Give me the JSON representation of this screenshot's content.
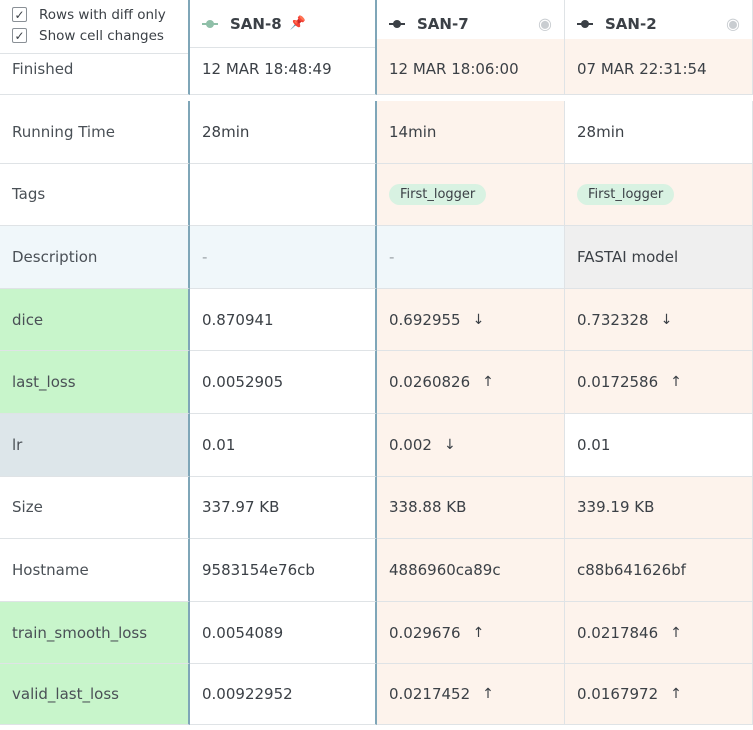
{
  "options": {
    "rows_with_diff_only": "Rows with diff only",
    "show_cell_changes": "Show cell changes"
  },
  "experiments": [
    {
      "name": "SAN-8",
      "icon": "experiment-light-icon",
      "marker": "pin-icon"
    },
    {
      "name": "SAN-7",
      "icon": "experiment-icon",
      "marker": "eye-icon"
    },
    {
      "name": "SAN-2",
      "icon": "experiment-icon",
      "marker": "eye-icon"
    }
  ],
  "rows": [
    {
      "label": "Finished",
      "values": [
        "12 MAR 18:48:49",
        "12 MAR 18:06:00",
        "07 MAR 22:31:54"
      ]
    },
    {
      "label": "Running Time",
      "values": [
        "28min",
        "14min",
        "28min"
      ]
    },
    {
      "label": "Tags",
      "values": [
        "",
        "First_logger",
        "First_logger"
      ]
    },
    {
      "label": "Description",
      "values": [
        "-",
        "-",
        "FASTAI model"
      ]
    },
    {
      "label": "dice",
      "values": [
        "0.870941",
        "0.692955",
        "0.732328"
      ],
      "arrows": [
        "",
        "↓",
        "↓"
      ]
    },
    {
      "label": "last_loss",
      "values": [
        "0.0052905",
        "0.0260826",
        "0.0172586"
      ],
      "arrows": [
        "",
        "↑",
        "↑"
      ]
    },
    {
      "label": "lr",
      "values": [
        "0.01",
        "0.002",
        "0.01"
      ],
      "arrows": [
        "",
        "↓",
        ""
      ]
    },
    {
      "label": "Size",
      "values": [
        "337.97 KB",
        "338.88 KB",
        "339.19 KB"
      ]
    },
    {
      "label": "Hostname",
      "values": [
        "9583154e76cb",
        "4886960ca89c",
        "c88b641626bf"
      ]
    },
    {
      "label": "train_smooth_loss",
      "values": [
        "0.0054089",
        "0.029676",
        "0.0217846"
      ],
      "arrows": [
        "",
        "↑",
        "↑"
      ]
    },
    {
      "label": "valid_last_loss",
      "values": [
        "0.00922952",
        "0.0217452",
        "0.0167972"
      ],
      "arrows": [
        "",
        "↑",
        "↑"
      ]
    }
  ],
  "colors": {
    "diff_tint": "#fdf3ec",
    "metric_highlight": "#c8f5cb",
    "tag_background": "#d8f2e2",
    "column_divider": "#7fa6b8"
  }
}
